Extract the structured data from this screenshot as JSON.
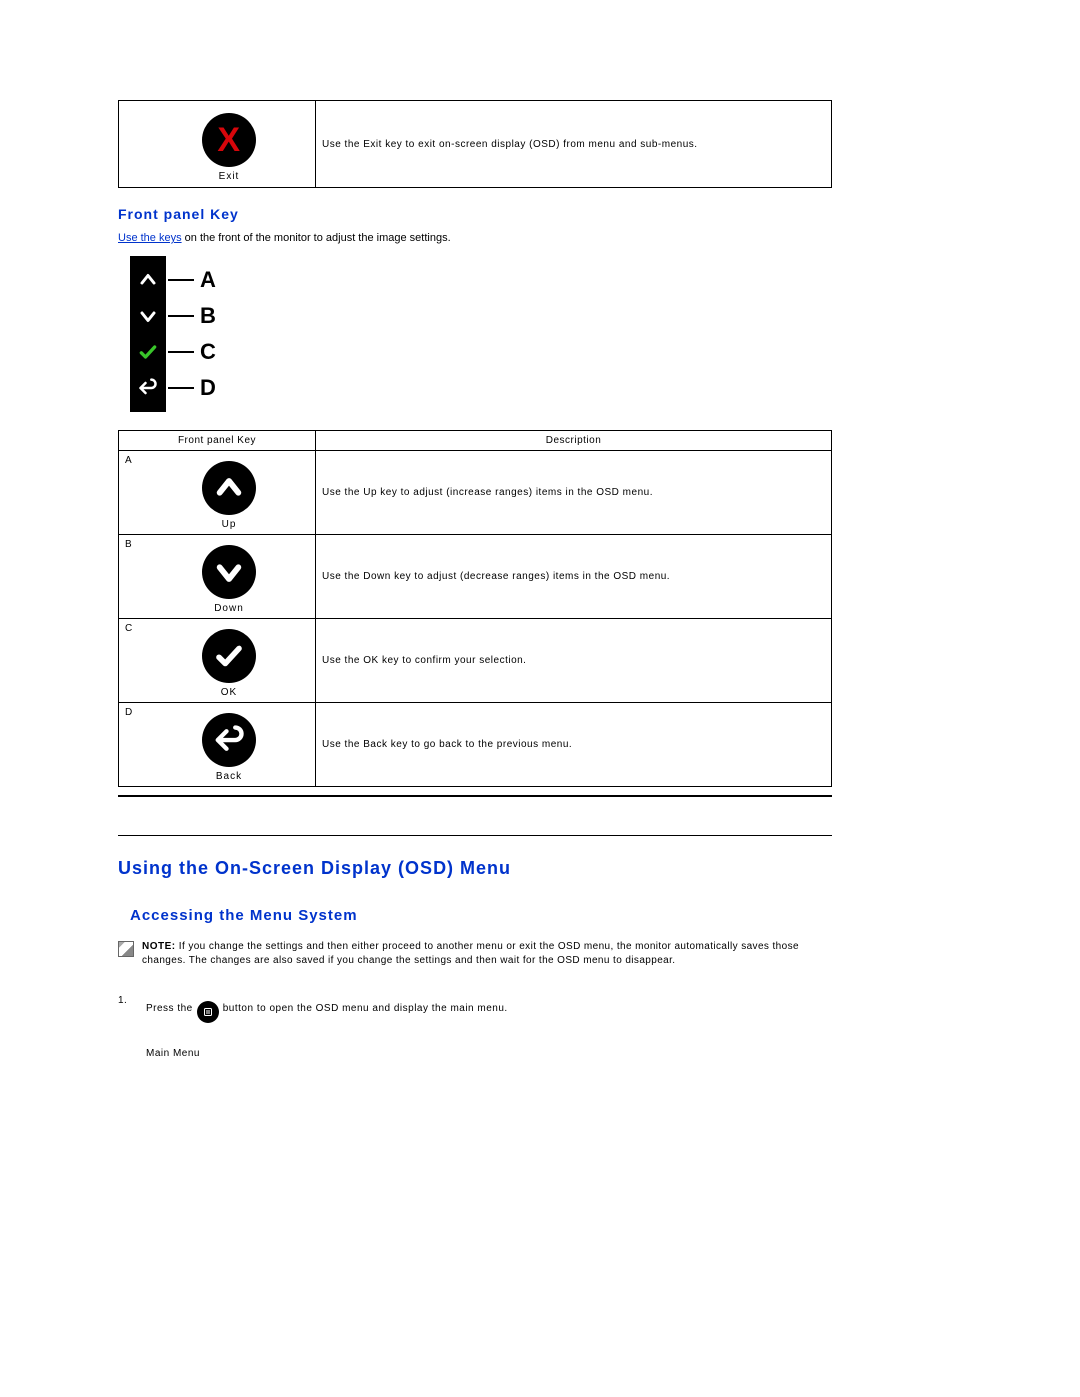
{
  "exit_row": {
    "icon_label": "Exit",
    "description": "Use the Exit key to exit on-screen display (OSD) from menu and sub-menus."
  },
  "front_panel": {
    "heading": "Front panel Key",
    "link_text": "Use the keys",
    "sentence_tail": " on the front of the monitor to adjust the image settings.",
    "diagram_labels": [
      "A",
      "B",
      "C",
      "D"
    ],
    "table_headers": {
      "col1": "Front panel Key",
      "col2": "Description"
    },
    "rows": [
      {
        "letter": "A",
        "icon_label": "Up",
        "description": "Use the Up key to adjust (increase ranges) items in the OSD menu."
      },
      {
        "letter": "B",
        "icon_label": "Down",
        "description": "Use the Down key to adjust (decrease ranges) items in the OSD menu."
      },
      {
        "letter": "C",
        "icon_label": "OK",
        "description": "Use the OK key to confirm your selection."
      },
      {
        "letter": "D",
        "icon_label": "Back",
        "description": "Use the Back key to go back to the previous menu."
      }
    ]
  },
  "osd": {
    "heading": "Using the On-Screen Display (OSD) Menu",
    "subheading": "Accessing the Menu System",
    "note_label": "NOTE:",
    "note_text": " If you change the settings and then either proceed to another menu or exit the OSD menu, the monitor automatically saves those changes. The changes are also saved if you change the settings and then wait for the OSD menu to disappear.",
    "step1_num": "1.",
    "step1_pre": "Press the ",
    "step1_post": " button to open the OSD menu and display the main menu.",
    "main_menu_label": "Main Menu"
  }
}
